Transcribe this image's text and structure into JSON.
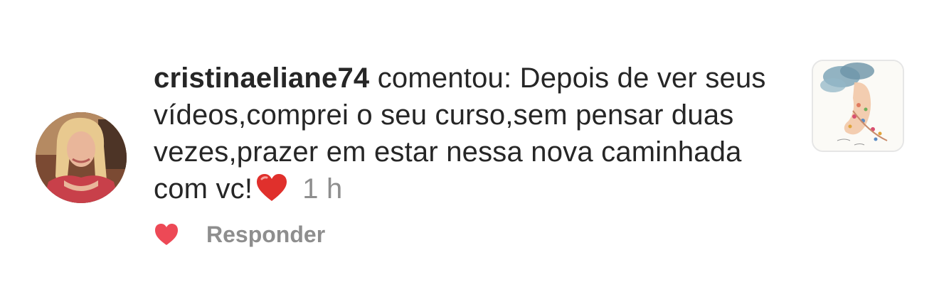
{
  "comment": {
    "username": "cristinaeliane74",
    "verb": "comentou:",
    "text": "Depois de ver seus vídeos,comprei o seu curso,sem pensar duas vezes,prazer em estar nessa nova caminhada  com vc!",
    "emoji": "heart-emoji",
    "time": "1 h"
  },
  "actions": {
    "like_icon": "heart-icon",
    "reply_label": "Responder"
  },
  "colors": {
    "text": "#262626",
    "secondary": "#8e8e8e",
    "heart": "#ed4956"
  }
}
